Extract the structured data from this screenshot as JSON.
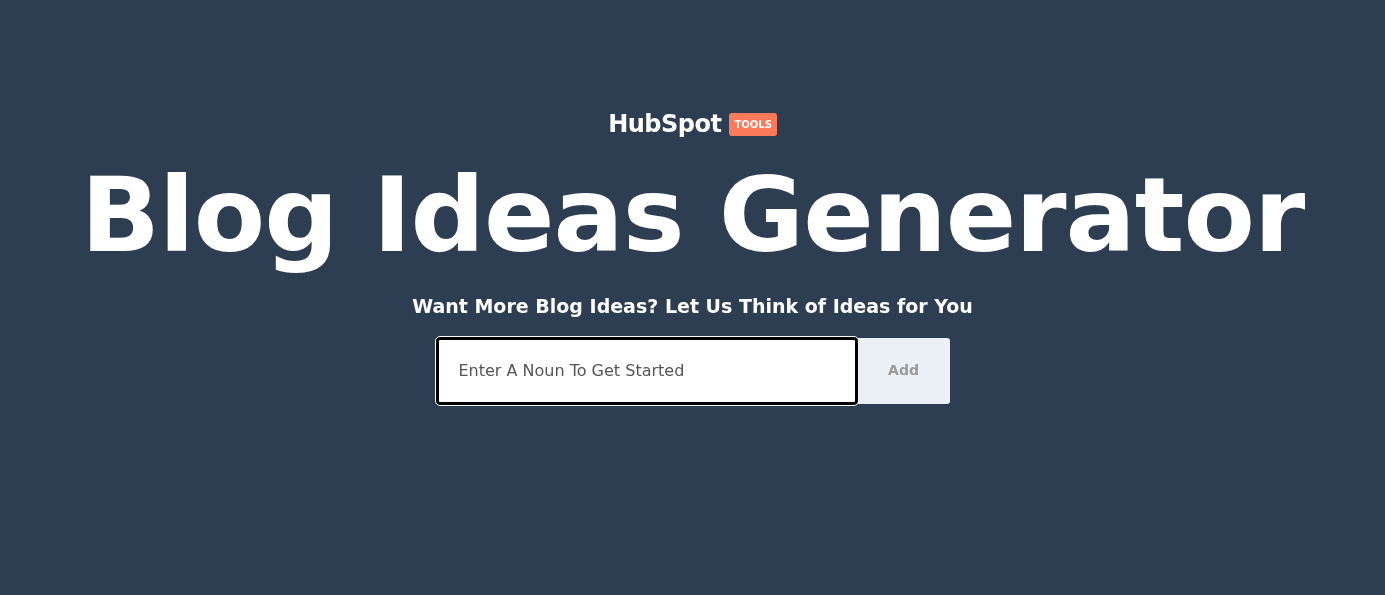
{
  "logo": {
    "text": "HubSpot",
    "badge": "TOOLS"
  },
  "title": "Blog Ideas Generator",
  "subtitle": "Want More Blog Ideas? Let Us Think of Ideas for You",
  "search": {
    "placeholder": "Enter A Noun To Get Started"
  },
  "button": {
    "label": "Add",
    "disabled": true
  }
}
